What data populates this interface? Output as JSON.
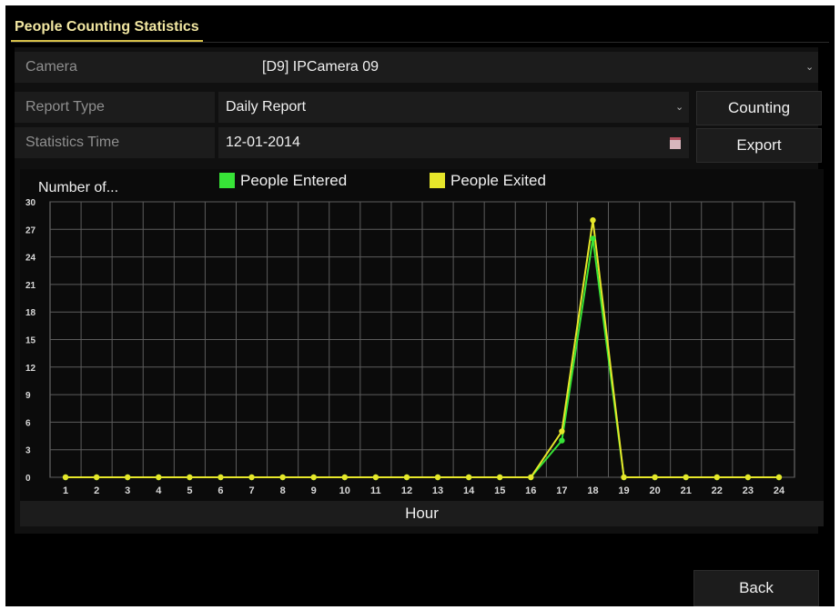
{
  "tab_title": "People Counting Statistics",
  "form": {
    "camera_label": "Camera",
    "camera_value": "[D9] IPCamera 09",
    "report_type_label": "Report Type",
    "report_type_value": "Daily Report",
    "statistics_time_label": "Statistics Time",
    "statistics_time_value": "12-01-2014"
  },
  "buttons": {
    "counting": "Counting",
    "export": "Export",
    "back": "Back"
  },
  "icons": {
    "dropdown": "chevron-down-icon",
    "calendar": "calendar-icon"
  },
  "colors": {
    "entered": "#37e337",
    "exited": "#e6e62a",
    "tab_accent": "#d8c24a"
  },
  "chart_data": {
    "type": "line",
    "ylabel": "Number of...",
    "xlabel": "Hour",
    "ylim": [
      0,
      30
    ],
    "yticks": [
      0,
      3,
      6,
      9,
      12,
      15,
      18,
      21,
      24,
      27,
      30
    ],
    "x": [
      1,
      2,
      3,
      4,
      5,
      6,
      7,
      8,
      9,
      10,
      11,
      12,
      13,
      14,
      15,
      16,
      17,
      18,
      19,
      20,
      21,
      22,
      23,
      24
    ],
    "grid": true,
    "legend": "top",
    "series": [
      {
        "name": "People Entered",
        "color": "#37e337",
        "values": [
          0,
          0,
          0,
          0,
          0,
          0,
          0,
          0,
          0,
          0,
          0,
          0,
          0,
          0,
          0,
          0,
          4,
          26,
          0,
          0,
          0,
          0,
          0,
          0
        ]
      },
      {
        "name": "People Exited",
        "color": "#e6e62a",
        "values": [
          0,
          0,
          0,
          0,
          0,
          0,
          0,
          0,
          0,
          0,
          0,
          0,
          0,
          0,
          0,
          0,
          5,
          28,
          0,
          0,
          0,
          0,
          0,
          0
        ]
      }
    ]
  }
}
